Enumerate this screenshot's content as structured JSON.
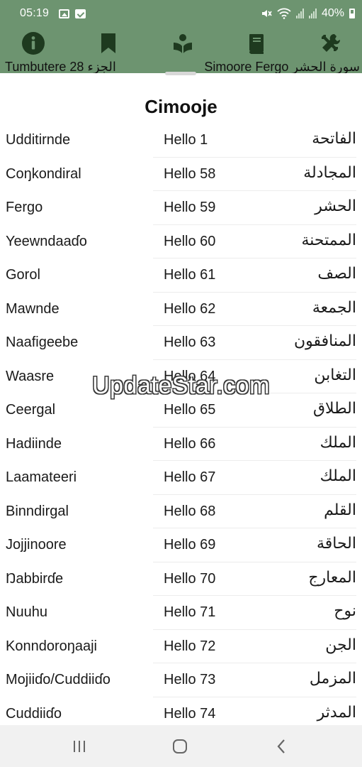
{
  "status_bar": {
    "time": "05:19",
    "battery": "40%"
  },
  "toolbar": {
    "icons": [
      "info-icon",
      "bookmark-icon",
      "reader-icon",
      "book-icon",
      "tools-icon"
    ],
    "juz_label": "Tumbutere 28 الجزء",
    "surah_label": "Simoore Fergo سورة الحشر"
  },
  "sheet": {
    "title": "Cimooje",
    "rows": [
      {
        "name": "Udditirnde",
        "num": "Hello 1",
        "ar": "الفاتحة"
      },
      {
        "name": "Coŋkondiral",
        "num": "Hello 58",
        "ar": "المجادلة"
      },
      {
        "name": "Fergo",
        "num": "Hello 59",
        "ar": "الحشر"
      },
      {
        "name": "Yeewndaaɗo",
        "num": "Hello 60",
        "ar": "الممتحنة"
      },
      {
        "name": "Gorol",
        "num": "Hello 61",
        "ar": "الصف"
      },
      {
        "name": "Mawnde",
        "num": "Hello 62",
        "ar": "الجمعة"
      },
      {
        "name": "Naafigeebe",
        "num": "Hello 63",
        "ar": "المنافقون"
      },
      {
        "name": "Waasre",
        "num": "Hello 64",
        "ar": "التغابن"
      },
      {
        "name": "Ceergal",
        "num": "Hello 65",
        "ar": "الطلاق"
      },
      {
        "name": "Hadiinde",
        "num": "Hello 66",
        "ar": "الملك"
      },
      {
        "name": "Laamateeri",
        "num": "Hello 67",
        "ar": "الملك"
      },
      {
        "name": "Binndirgal",
        "num": "Hello 68",
        "ar": "القلم"
      },
      {
        "name": "Jojjinoore",
        "num": "Hello 69",
        "ar": "الحاقة"
      },
      {
        "name": "Ŋabbirɗe",
        "num": "Hello 70",
        "ar": "المعارج"
      },
      {
        "name": "Nuuhu",
        "num": "Hello 71",
        "ar": "نوح"
      },
      {
        "name": "Konndoroŋaaji",
        "num": "Hello 72",
        "ar": "الجن"
      },
      {
        "name": "Mojiiɗo/Cuddiiɗo",
        "num": "Hello 73",
        "ar": "المزمل"
      },
      {
        "name": "Cuddiiɗo",
        "num": "Hello 74",
        "ar": "المدثر"
      }
    ]
  },
  "watermark": "UpdateStar.com",
  "nav": {
    "icons": [
      "recent-apps-icon",
      "home-icon",
      "back-icon"
    ]
  },
  "colors": {
    "toolbar_bg": "#6d9470",
    "icon_dark": "#1e3a1f",
    "sheet_bg": "#ffffff",
    "nav_bg": "#f1f1f1"
  }
}
